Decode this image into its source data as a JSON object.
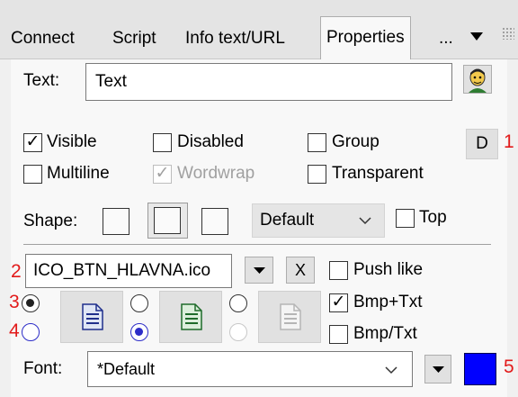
{
  "tabs": [
    {
      "label": "Connect"
    },
    {
      "label": "Script"
    },
    {
      "label": "Info text/URL"
    },
    {
      "label": "Properties"
    },
    {
      "label": "..."
    }
  ],
  "text_field": {
    "label": "Text:",
    "value": "Text"
  },
  "checkboxes": {
    "visible": {
      "label": "Visible",
      "checked": true
    },
    "disabled": {
      "label": "Disabled",
      "checked": false
    },
    "group": {
      "label": "Group",
      "checked": false
    },
    "multiline": {
      "label": "Multiline",
      "checked": false
    },
    "wordwrap": {
      "label": "Wordwrap",
      "checked": true,
      "enabled": false
    },
    "transparent": {
      "label": "Transparent",
      "checked": false
    },
    "top": {
      "label": "Top",
      "checked": false
    },
    "push_like": {
      "label": "Push like",
      "checked": false
    },
    "bmp_txt": {
      "label": "Bmp+Txt",
      "checked": true
    },
    "bmp_over_txt": {
      "label": "Bmp/Txt",
      "checked": false
    }
  },
  "d_button": {
    "label": "D"
  },
  "shape": {
    "label": "Shape:",
    "selected": "Default"
  },
  "icon_file": {
    "value": "ICO_BTN_HLAVNA.ico",
    "clear_label": "X"
  },
  "font": {
    "label": "Font:",
    "value": "*Default"
  },
  "markers": [
    "1",
    "2",
    "3",
    "4",
    "5"
  ],
  "colors": {
    "font_color": "#0000ff",
    "marker": "#e21b1b"
  }
}
